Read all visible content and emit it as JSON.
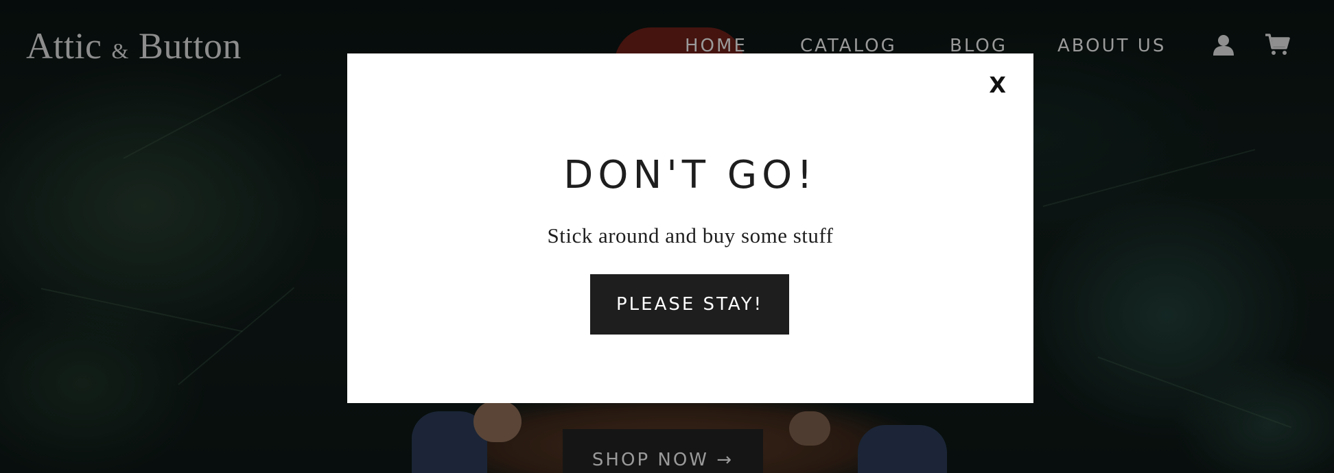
{
  "header": {
    "logo_prefix": "Attic",
    "logo_amp": "&",
    "logo_suffix": "Button",
    "nav": [
      {
        "label": "HOME"
      },
      {
        "label": "CATALOG"
      },
      {
        "label": "BLOG"
      },
      {
        "label": "ABOUT US"
      }
    ],
    "account_icon": "user-icon",
    "cart_icon": "cart-icon"
  },
  "hero": {
    "button_label": "SHOP NOW →"
  },
  "modal": {
    "close_label": "X",
    "title": "DON'T GO!",
    "subtitle": "Stick around and buy some stuff",
    "button_label": "PLEASE STAY!"
  },
  "colors": {
    "modal_bg": "#ffffff",
    "button_bg": "#1e1e1e",
    "text_dark": "#1e1e1e",
    "nav_text": "#9a9a9a"
  }
}
